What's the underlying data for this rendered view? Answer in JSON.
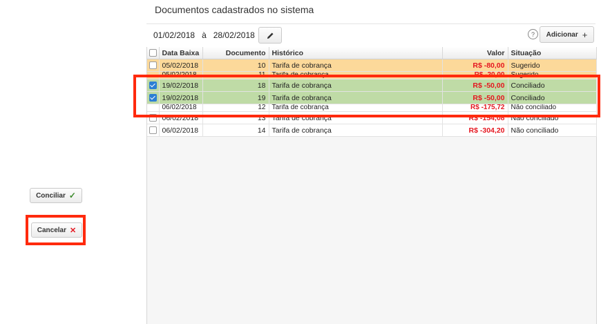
{
  "panel": {
    "title": "Documentos cadastrados no sistema"
  },
  "date_range": {
    "start": "01/02/2018",
    "separator": "à",
    "end": "28/02/2018"
  },
  "toolbar": {
    "help": "?",
    "add_label": "Adicionar",
    "add_symbol": "+"
  },
  "table": {
    "columns": [
      "Data Baixa",
      "Documento",
      "Histórico",
      "Valor",
      "Situação"
    ],
    "rows": [
      {
        "date": "05/02/2018",
        "doc": "10",
        "hist": "Tarifa de cobrança",
        "valor": "R$ -80,00",
        "situacao": "Sugerido",
        "checked": false
      },
      {
        "date": "05/02/2018",
        "doc": "11",
        "hist": "Tarifa de cobrança",
        "valor": "R$ -20,00",
        "situacao": "Sugerido",
        "checked": false
      },
      {
        "date": "19/02/2018",
        "doc": "18",
        "hist": "Tarifa de cobrança",
        "valor": "R$ -50,00",
        "situacao": "Conciliado",
        "checked": true
      },
      {
        "date": "19/02/2018",
        "doc": "19",
        "hist": "Tarifa de cobrança",
        "valor": "R$ -50,00",
        "situacao": "Conciliado",
        "checked": true
      },
      {
        "date": "06/02/2018",
        "doc": "12",
        "hist": "Tarifa de cobrança",
        "valor": "R$ -175,72",
        "situacao": "Não conciliado",
        "checked": false
      },
      {
        "date": "06/02/2018",
        "doc": "13",
        "hist": "Tarifa de cobrança",
        "valor": "R$ -154,08",
        "situacao": "Não conciliado",
        "checked": false
      },
      {
        "date": "06/02/2018",
        "doc": "14",
        "hist": "Tarifa de cobrança",
        "valor": "R$ -304,20",
        "situacao": "Não conciliado",
        "checked": false
      }
    ]
  },
  "actions": {
    "conciliar": "Conciliar",
    "conciliar_symbol": "✓",
    "cancelar": "Cancelar",
    "cancelar_symbol": "✕"
  },
  "colors": {
    "highlight": "#ff2a0d",
    "sugerido": "#fcd99a",
    "conciliado": "#bfdba6",
    "negative": "#e5161f"
  }
}
